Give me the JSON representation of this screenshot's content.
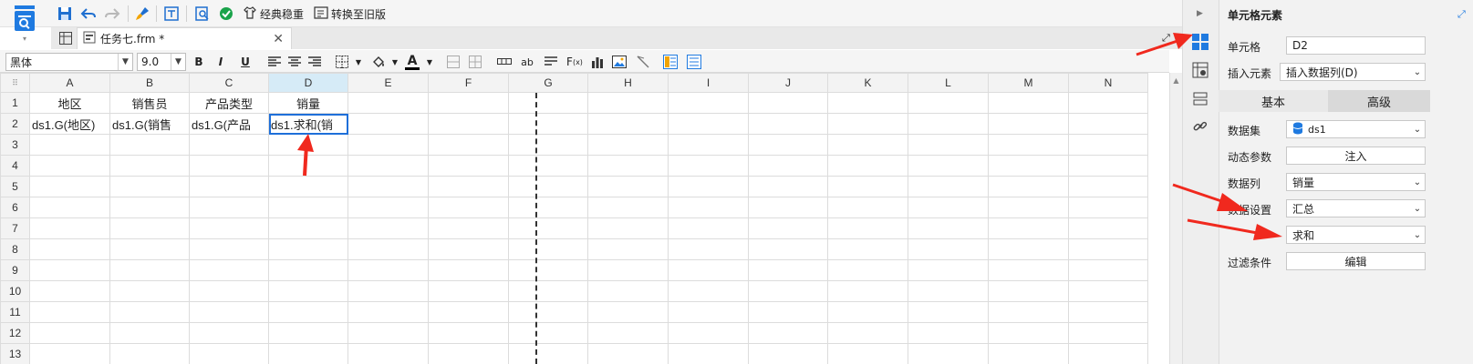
{
  "toolbar": {
    "theme_label": "经典稳重",
    "switch_label": "转换至旧版"
  },
  "tab": {
    "title": "任务七.frm *"
  },
  "format": {
    "font": "黑体",
    "size": "9.0",
    "bold": "B",
    "italic": "I",
    "underline": "U",
    "text_color_glyph": "A"
  },
  "sheet": {
    "columns": [
      "A",
      "B",
      "C",
      "D",
      "E",
      "F",
      "G",
      "H",
      "I",
      "J",
      "K",
      "L",
      "M",
      "N"
    ],
    "active_column": "D",
    "rows": [
      "1",
      "2",
      "3",
      "4",
      "5",
      "6",
      "7",
      "8",
      "9",
      "10",
      "11",
      "12",
      "13"
    ],
    "headers": [
      "地区",
      "销售员",
      "产品类型",
      "销量"
    ],
    "row2": [
      "ds1.G(地区)",
      "ds1.G(销售",
      "ds1.G(产品",
      "ds1.求和(销"
    ]
  },
  "panel": {
    "title": "单元格元素",
    "cell_label": "单元格",
    "cell_value": "D2",
    "insert_label": "插入元素",
    "insert_value": "插入数据列(D)",
    "tab_basic": "基本",
    "tab_advanced": "高级",
    "dataset_label": "数据集",
    "dataset_value": "ds1",
    "dynamic_param_label": "动态参数",
    "inject_button": "注入",
    "data_column_label": "数据列",
    "data_column_value": "销量",
    "data_setting_label": "数据设置",
    "data_setting_value": "汇总",
    "aggregate_value": "求和",
    "filter_label": "过滤条件",
    "edit_button": "编辑"
  },
  "colors": {
    "accent": "#1e6fd9",
    "arrow": "#f0291e",
    "active_header": "#d6ebf7"
  }
}
